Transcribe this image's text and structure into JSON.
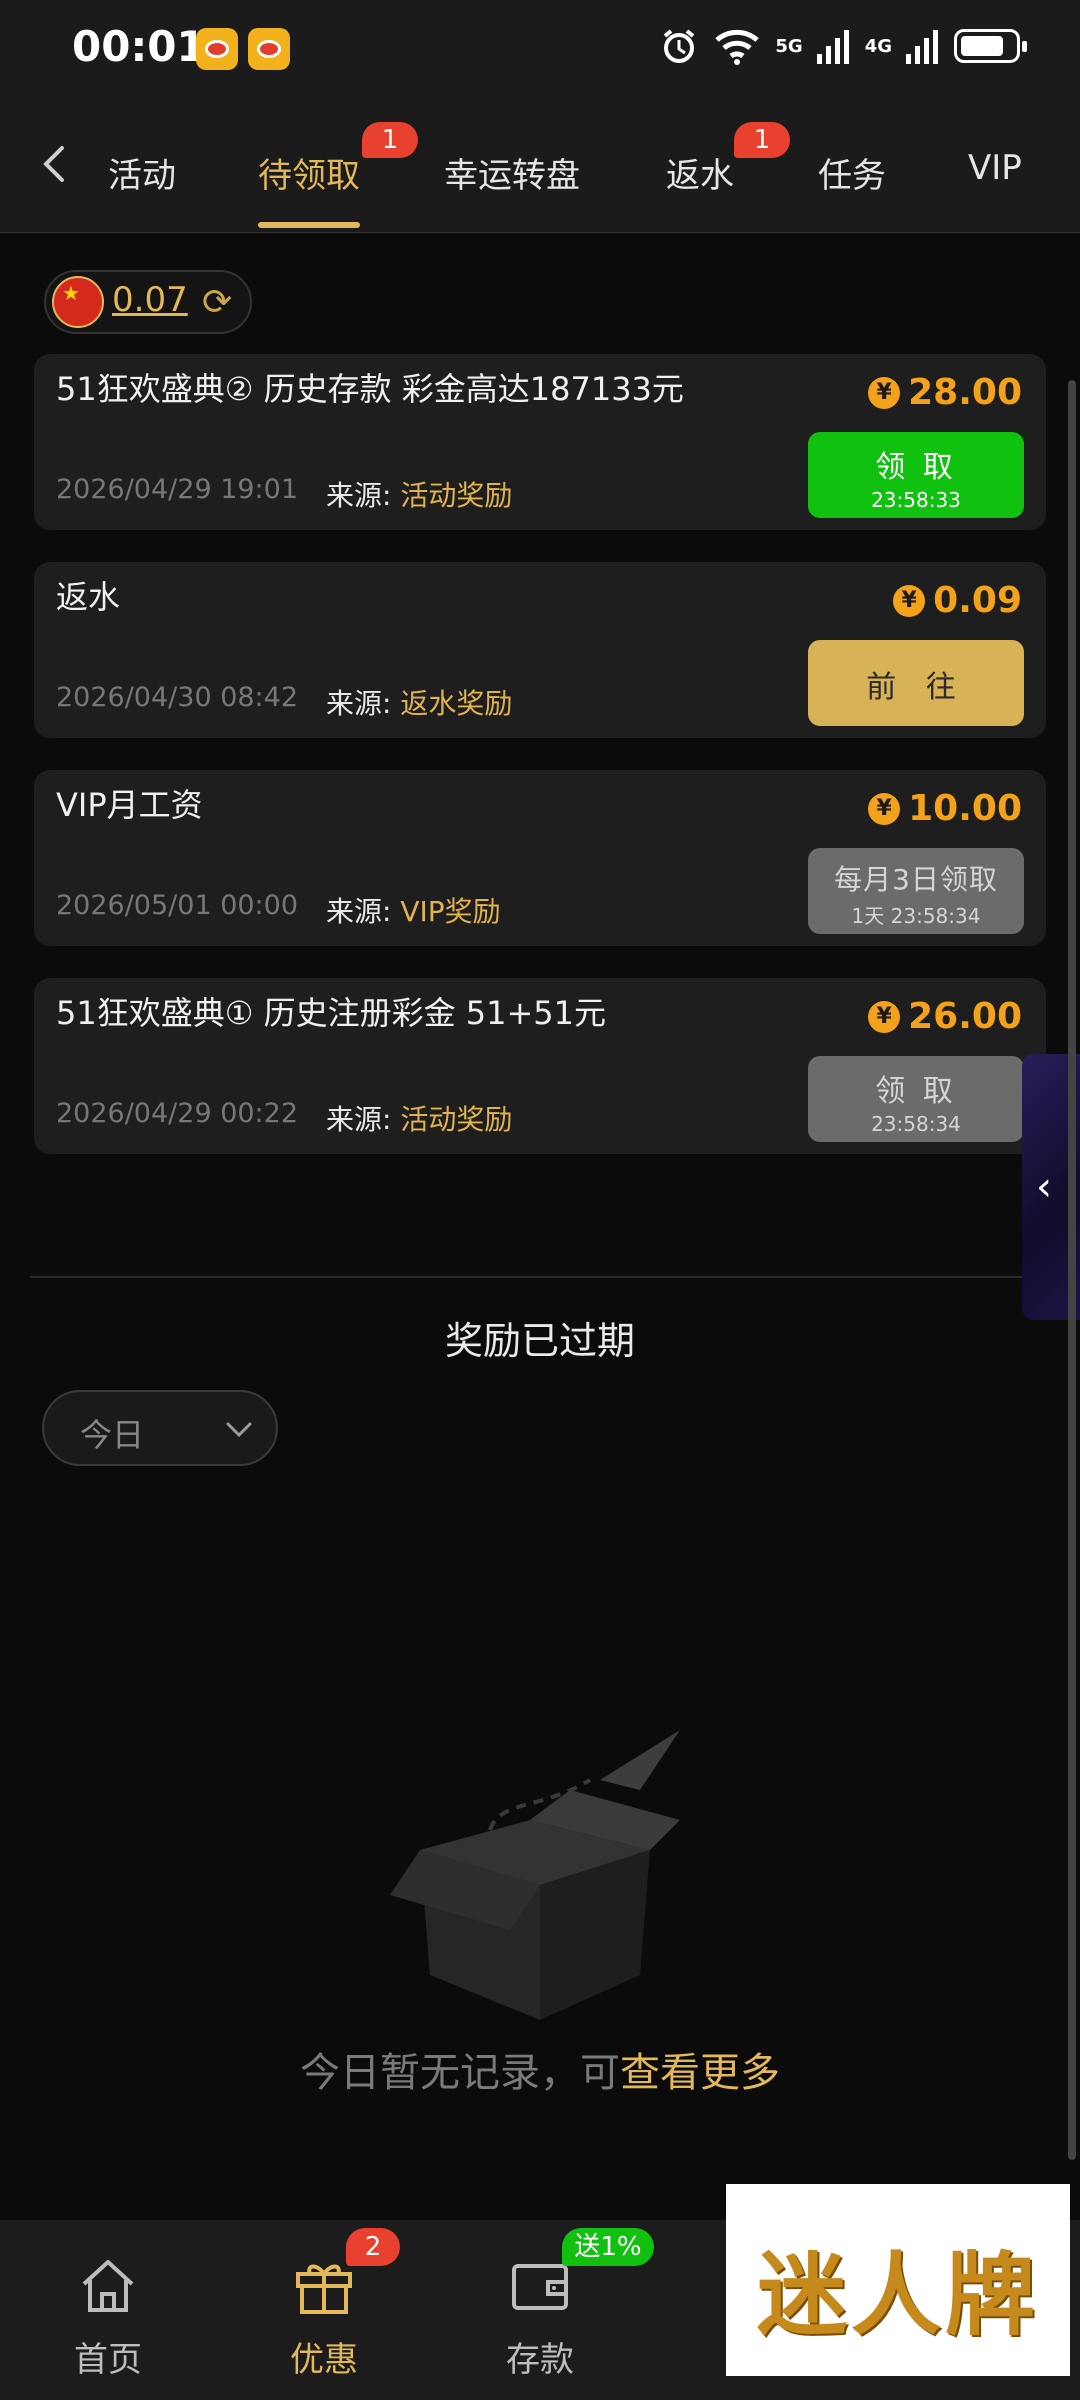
{
  "status_bar": {
    "time": "00:01",
    "net1": "5G",
    "net2": "4G"
  },
  "tabs": [
    {
      "label": "活动",
      "active": false
    },
    {
      "label": "待领取",
      "active": true,
      "badge": "1"
    },
    {
      "label": "幸运转盘",
      "active": false
    },
    {
      "label": "返水",
      "active": false,
      "badge": "1"
    },
    {
      "label": "任务",
      "active": false
    },
    {
      "label": "VIP",
      "active": false
    }
  ],
  "balance": {
    "value": "0.07"
  },
  "source_label": "来源:",
  "rewards": [
    {
      "title": "51狂欢盛典② 历史存款 彩金高达187133元",
      "date": "2026/04/29 19:01",
      "source": "活动奖励",
      "amount": "28.00",
      "action_label": "领 取",
      "action_sub": "23:58:33"
    },
    {
      "title": "返水",
      "date": "2026/04/30 08:42",
      "source": "返水奖励",
      "amount": "0.09",
      "action_label": "前 往",
      "action_sub": ""
    },
    {
      "title": "VIP月工资",
      "date": "2026/05/01 00:00",
      "source": "VIP奖励",
      "amount": "10.00",
      "action_label": "每月3日领取",
      "action_sub": "1天 23:58:34"
    },
    {
      "title": "51狂欢盛典① 历史注册彩金 51+51元",
      "date": "2026/04/29 00:22",
      "source": "活动奖励",
      "amount": "26.00",
      "action_label": "领 取",
      "action_sub": "23:58:34"
    }
  ],
  "expired": {
    "title": "奖励已过期",
    "filter_value": "今日",
    "empty_text": "今日暂无记录，可",
    "more_link": "查看更多"
  },
  "bottom_nav": [
    {
      "label": "首页",
      "icon": "home-icon"
    },
    {
      "label": "优惠",
      "icon": "gift-icon",
      "badge": "2",
      "active": true
    },
    {
      "label": "存款",
      "icon": "wallet-icon",
      "badge": "送1%"
    }
  ],
  "promo": {
    "text": "迷人牌"
  },
  "colors": {
    "accent": "#e2b85a",
    "amount": "#f5a21b",
    "claim": "#10c10f",
    "badge": "#e8412f"
  }
}
